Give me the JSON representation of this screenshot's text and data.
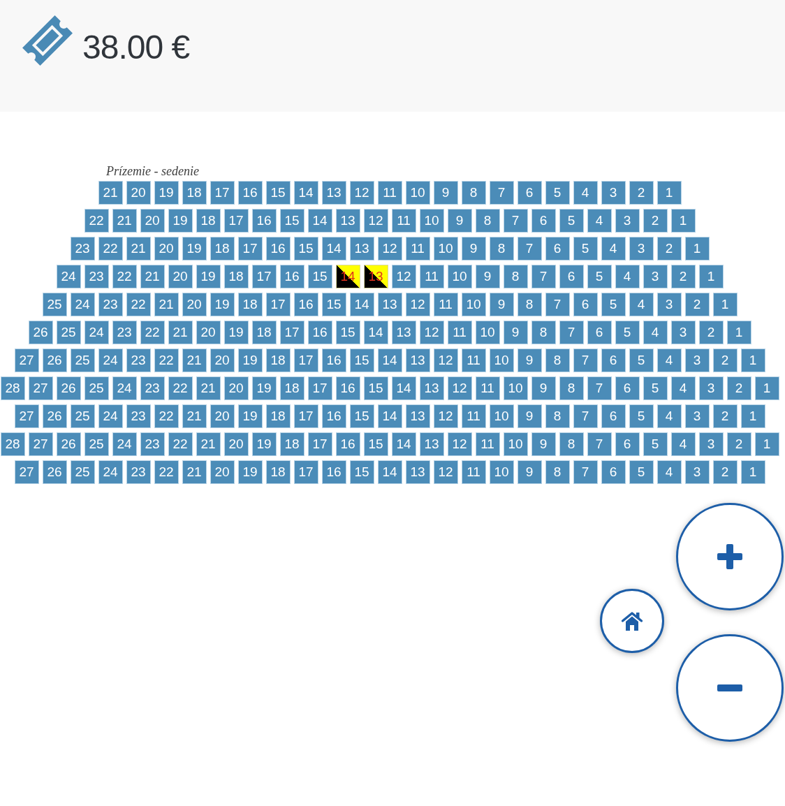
{
  "header": {
    "price": "38.00 €"
  },
  "seat_map": {
    "section_label": "Prízemie - sedenie",
    "rows": [
      {
        "seats": [
          {
            "number": "21",
            "selected": false
          },
          {
            "number": "20",
            "selected": false
          },
          {
            "number": "19",
            "selected": false
          },
          {
            "number": "18",
            "selected": false
          },
          {
            "number": "17",
            "selected": false
          },
          {
            "number": "16",
            "selected": false
          },
          {
            "number": "15",
            "selected": false
          },
          {
            "number": "14",
            "selected": false
          },
          {
            "number": "13",
            "selected": false
          },
          {
            "number": "12",
            "selected": false
          },
          {
            "number": "11",
            "selected": false
          },
          {
            "number": "10",
            "selected": false
          },
          {
            "number": "9",
            "selected": false
          },
          {
            "number": "8",
            "selected": false
          },
          {
            "number": "7",
            "selected": false
          },
          {
            "number": "6",
            "selected": false
          },
          {
            "number": "5",
            "selected": false
          },
          {
            "number": "4",
            "selected": false
          },
          {
            "number": "3",
            "selected": false
          },
          {
            "number": "2",
            "selected": false
          },
          {
            "number": "1",
            "selected": false
          }
        ]
      },
      {
        "seats": [
          {
            "number": "22",
            "selected": false
          },
          {
            "number": "21",
            "selected": false
          },
          {
            "number": "20",
            "selected": false
          },
          {
            "number": "19",
            "selected": false
          },
          {
            "number": "18",
            "selected": false
          },
          {
            "number": "17",
            "selected": false
          },
          {
            "number": "16",
            "selected": false
          },
          {
            "number": "15",
            "selected": false
          },
          {
            "number": "14",
            "selected": false
          },
          {
            "number": "13",
            "selected": false
          },
          {
            "number": "12",
            "selected": false
          },
          {
            "number": "11",
            "selected": false
          },
          {
            "number": "10",
            "selected": false
          },
          {
            "number": "9",
            "selected": false
          },
          {
            "number": "8",
            "selected": false
          },
          {
            "number": "7",
            "selected": false
          },
          {
            "number": "6",
            "selected": false
          },
          {
            "number": "5",
            "selected": false
          },
          {
            "number": "4",
            "selected": false
          },
          {
            "number": "3",
            "selected": false
          },
          {
            "number": "2",
            "selected": false
          },
          {
            "number": "1",
            "selected": false
          }
        ]
      },
      {
        "seats": [
          {
            "number": "23",
            "selected": false
          },
          {
            "number": "22",
            "selected": false
          },
          {
            "number": "21",
            "selected": false
          },
          {
            "number": "20",
            "selected": false
          },
          {
            "number": "19",
            "selected": false
          },
          {
            "number": "18",
            "selected": false
          },
          {
            "number": "17",
            "selected": false
          },
          {
            "number": "16",
            "selected": false
          },
          {
            "number": "15",
            "selected": false
          },
          {
            "number": "14",
            "selected": false
          },
          {
            "number": "13",
            "selected": false
          },
          {
            "number": "12",
            "selected": false
          },
          {
            "number": "11",
            "selected": false
          },
          {
            "number": "10",
            "selected": false
          },
          {
            "number": "9",
            "selected": false
          },
          {
            "number": "8",
            "selected": false
          },
          {
            "number": "7",
            "selected": false
          },
          {
            "number": "6",
            "selected": false
          },
          {
            "number": "5",
            "selected": false
          },
          {
            "number": "4",
            "selected": false
          },
          {
            "number": "3",
            "selected": false
          },
          {
            "number": "2",
            "selected": false
          },
          {
            "number": "1",
            "selected": false
          }
        ]
      },
      {
        "seats": [
          {
            "number": "24",
            "selected": false
          },
          {
            "number": "23",
            "selected": false
          },
          {
            "number": "22",
            "selected": false
          },
          {
            "number": "21",
            "selected": false
          },
          {
            "number": "20",
            "selected": false
          },
          {
            "number": "19",
            "selected": false
          },
          {
            "number": "18",
            "selected": false
          },
          {
            "number": "17",
            "selected": false
          },
          {
            "number": "16",
            "selected": false
          },
          {
            "number": "15",
            "selected": false
          },
          {
            "number": "14",
            "selected": true
          },
          {
            "number": "13",
            "selected": true
          },
          {
            "number": "12",
            "selected": false
          },
          {
            "number": "11",
            "selected": false
          },
          {
            "number": "10",
            "selected": false
          },
          {
            "number": "9",
            "selected": false
          },
          {
            "number": "8",
            "selected": false
          },
          {
            "number": "7",
            "selected": false
          },
          {
            "number": "6",
            "selected": false
          },
          {
            "number": "5",
            "selected": false
          },
          {
            "number": "4",
            "selected": false
          },
          {
            "number": "3",
            "selected": false
          },
          {
            "number": "2",
            "selected": false
          },
          {
            "number": "1",
            "selected": false
          }
        ]
      },
      {
        "seats": [
          {
            "number": "25",
            "selected": false
          },
          {
            "number": "24",
            "selected": false
          },
          {
            "number": "23",
            "selected": false
          },
          {
            "number": "22",
            "selected": false
          },
          {
            "number": "21",
            "selected": false
          },
          {
            "number": "20",
            "selected": false
          },
          {
            "number": "19",
            "selected": false
          },
          {
            "number": "18",
            "selected": false
          },
          {
            "number": "17",
            "selected": false
          },
          {
            "number": "16",
            "selected": false
          },
          {
            "number": "15",
            "selected": false
          },
          {
            "number": "14",
            "selected": false
          },
          {
            "number": "13",
            "selected": false
          },
          {
            "number": "12",
            "selected": false
          },
          {
            "number": "11",
            "selected": false
          },
          {
            "number": "10",
            "selected": false
          },
          {
            "number": "9",
            "selected": false
          },
          {
            "number": "8",
            "selected": false
          },
          {
            "number": "7",
            "selected": false
          },
          {
            "number": "6",
            "selected": false
          },
          {
            "number": "5",
            "selected": false
          },
          {
            "number": "4",
            "selected": false
          },
          {
            "number": "3",
            "selected": false
          },
          {
            "number": "2",
            "selected": false
          },
          {
            "number": "1",
            "selected": false
          }
        ]
      },
      {
        "seats": [
          {
            "number": "26",
            "selected": false
          },
          {
            "number": "25",
            "selected": false
          },
          {
            "number": "24",
            "selected": false
          },
          {
            "number": "23",
            "selected": false
          },
          {
            "number": "22",
            "selected": false
          },
          {
            "number": "21",
            "selected": false
          },
          {
            "number": "20",
            "selected": false
          },
          {
            "number": "19",
            "selected": false
          },
          {
            "number": "18",
            "selected": false
          },
          {
            "number": "17",
            "selected": false
          },
          {
            "number": "16",
            "selected": false
          },
          {
            "number": "15",
            "selected": false
          },
          {
            "number": "14",
            "selected": false
          },
          {
            "number": "13",
            "selected": false
          },
          {
            "number": "12",
            "selected": false
          },
          {
            "number": "11",
            "selected": false
          },
          {
            "number": "10",
            "selected": false
          },
          {
            "number": "9",
            "selected": false
          },
          {
            "number": "8",
            "selected": false
          },
          {
            "number": "7",
            "selected": false
          },
          {
            "number": "6",
            "selected": false
          },
          {
            "number": "5",
            "selected": false
          },
          {
            "number": "4",
            "selected": false
          },
          {
            "number": "3",
            "selected": false
          },
          {
            "number": "2",
            "selected": false
          },
          {
            "number": "1",
            "selected": false
          }
        ]
      },
      {
        "seats": [
          {
            "number": "27",
            "selected": false
          },
          {
            "number": "26",
            "selected": false
          },
          {
            "number": "25",
            "selected": false
          },
          {
            "number": "24",
            "selected": false
          },
          {
            "number": "23",
            "selected": false
          },
          {
            "number": "22",
            "selected": false
          },
          {
            "number": "21",
            "selected": false
          },
          {
            "number": "20",
            "selected": false
          },
          {
            "number": "19",
            "selected": false
          },
          {
            "number": "18",
            "selected": false
          },
          {
            "number": "17",
            "selected": false
          },
          {
            "number": "16",
            "selected": false
          },
          {
            "number": "15",
            "selected": false
          },
          {
            "number": "14",
            "selected": false
          },
          {
            "number": "13",
            "selected": false
          },
          {
            "number": "12",
            "selected": false
          },
          {
            "number": "11",
            "selected": false
          },
          {
            "number": "10",
            "selected": false
          },
          {
            "number": "9",
            "selected": false
          },
          {
            "number": "8",
            "selected": false
          },
          {
            "number": "7",
            "selected": false
          },
          {
            "number": "6",
            "selected": false
          },
          {
            "number": "5",
            "selected": false
          },
          {
            "number": "4",
            "selected": false
          },
          {
            "number": "3",
            "selected": false
          },
          {
            "number": "2",
            "selected": false
          },
          {
            "number": "1",
            "selected": false
          }
        ]
      },
      {
        "seats": [
          {
            "number": "28",
            "selected": false
          },
          {
            "number": "27",
            "selected": false
          },
          {
            "number": "26",
            "selected": false
          },
          {
            "number": "25",
            "selected": false
          },
          {
            "number": "24",
            "selected": false
          },
          {
            "number": "23",
            "selected": false
          },
          {
            "number": "22",
            "selected": false
          },
          {
            "number": "21",
            "selected": false
          },
          {
            "number": "20",
            "selected": false
          },
          {
            "number": "19",
            "selected": false
          },
          {
            "number": "18",
            "selected": false
          },
          {
            "number": "17",
            "selected": false
          },
          {
            "number": "16",
            "selected": false
          },
          {
            "number": "15",
            "selected": false
          },
          {
            "number": "14",
            "selected": false
          },
          {
            "number": "13",
            "selected": false
          },
          {
            "number": "12",
            "selected": false
          },
          {
            "number": "11",
            "selected": false
          },
          {
            "number": "10",
            "selected": false
          },
          {
            "number": "9",
            "selected": false
          },
          {
            "number": "8",
            "selected": false
          },
          {
            "number": "7",
            "selected": false
          },
          {
            "number": "6",
            "selected": false
          },
          {
            "number": "5",
            "selected": false
          },
          {
            "number": "4",
            "selected": false
          },
          {
            "number": "3",
            "selected": false
          },
          {
            "number": "2",
            "selected": false
          },
          {
            "number": "1",
            "selected": false
          }
        ]
      },
      {
        "seats": [
          {
            "number": "27",
            "selected": false
          },
          {
            "number": "26",
            "selected": false
          },
          {
            "number": "25",
            "selected": false
          },
          {
            "number": "24",
            "selected": false
          },
          {
            "number": "23",
            "selected": false
          },
          {
            "number": "22",
            "selected": false
          },
          {
            "number": "21",
            "selected": false
          },
          {
            "number": "20",
            "selected": false
          },
          {
            "number": "19",
            "selected": false
          },
          {
            "number": "18",
            "selected": false
          },
          {
            "number": "17",
            "selected": false
          },
          {
            "number": "16",
            "selected": false
          },
          {
            "number": "15",
            "selected": false
          },
          {
            "number": "14",
            "selected": false
          },
          {
            "number": "13",
            "selected": false
          },
          {
            "number": "12",
            "selected": false
          },
          {
            "number": "11",
            "selected": false
          },
          {
            "number": "10",
            "selected": false
          },
          {
            "number": "9",
            "selected": false
          },
          {
            "number": "8",
            "selected": false
          },
          {
            "number": "7",
            "selected": false
          },
          {
            "number": "6",
            "selected": false
          },
          {
            "number": "5",
            "selected": false
          },
          {
            "number": "4",
            "selected": false
          },
          {
            "number": "3",
            "selected": false
          },
          {
            "number": "2",
            "selected": false
          },
          {
            "number": "1",
            "selected": false
          }
        ]
      },
      {
        "seats": [
          {
            "number": "28",
            "selected": false
          },
          {
            "number": "27",
            "selected": false
          },
          {
            "number": "26",
            "selected": false
          },
          {
            "number": "25",
            "selected": false
          },
          {
            "number": "24",
            "selected": false
          },
          {
            "number": "23",
            "selected": false
          },
          {
            "number": "22",
            "selected": false
          },
          {
            "number": "21",
            "selected": false
          },
          {
            "number": "20",
            "selected": false
          },
          {
            "number": "19",
            "selected": false
          },
          {
            "number": "18",
            "selected": false
          },
          {
            "number": "17",
            "selected": false
          },
          {
            "number": "16",
            "selected": false
          },
          {
            "number": "15",
            "selected": false
          },
          {
            "number": "14",
            "selected": false
          },
          {
            "number": "13",
            "selected": false
          },
          {
            "number": "12",
            "selected": false
          },
          {
            "number": "11",
            "selected": false
          },
          {
            "number": "10",
            "selected": false
          },
          {
            "number": "9",
            "selected": false
          },
          {
            "number": "8",
            "selected": false
          },
          {
            "number": "7",
            "selected": false
          },
          {
            "number": "6",
            "selected": false
          },
          {
            "number": "5",
            "selected": false
          },
          {
            "number": "4",
            "selected": false
          },
          {
            "number": "3",
            "selected": false
          },
          {
            "number": "2",
            "selected": false
          },
          {
            "number": "1",
            "selected": false
          }
        ]
      },
      {
        "seats": [
          {
            "number": "27",
            "selected": false
          },
          {
            "number": "26",
            "selected": false
          },
          {
            "number": "25",
            "selected": false
          },
          {
            "number": "24",
            "selected": false
          },
          {
            "number": "23",
            "selected": false
          },
          {
            "number": "22",
            "selected": false
          },
          {
            "number": "21",
            "selected": false
          },
          {
            "number": "20",
            "selected": false
          },
          {
            "number": "19",
            "selected": false
          },
          {
            "number": "18",
            "selected": false
          },
          {
            "number": "17",
            "selected": false
          },
          {
            "number": "16",
            "selected": false
          },
          {
            "number": "15",
            "selected": false
          },
          {
            "number": "14",
            "selected": false
          },
          {
            "number": "13",
            "selected": false
          },
          {
            "number": "12",
            "selected": false
          },
          {
            "number": "11",
            "selected": false
          },
          {
            "number": "10",
            "selected": false
          },
          {
            "number": "9",
            "selected": false
          },
          {
            "number": "8",
            "selected": false
          },
          {
            "number": "7",
            "selected": false
          },
          {
            "number": "6",
            "selected": false
          },
          {
            "number": "5",
            "selected": false
          },
          {
            "number": "4",
            "selected": false
          },
          {
            "number": "3",
            "selected": false
          },
          {
            "number": "2",
            "selected": false
          },
          {
            "number": "1",
            "selected": false
          }
        ]
      }
    ]
  }
}
